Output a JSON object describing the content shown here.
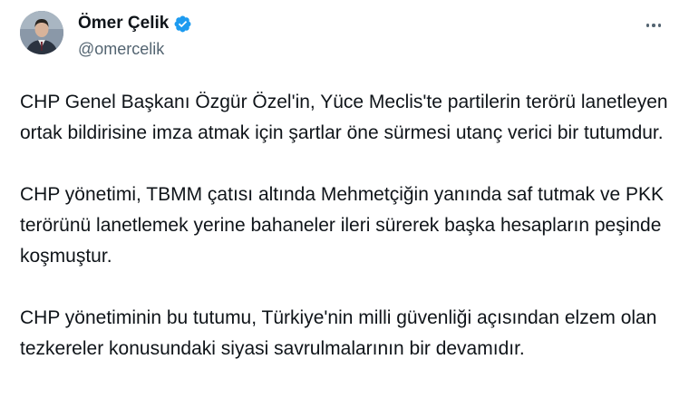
{
  "author": {
    "display_name": "Ömer Çelik",
    "handle": "@omercelik",
    "verified_icon": "verified-badge-icon",
    "verified_color": "#1d9bf0"
  },
  "more_icon": "more-horizontal-icon",
  "tweet": {
    "paragraphs": [
      "CHP Genel Başkanı Özgür Özel'in, Yüce Meclis'te partilerin terörü lanetleyen ortak bildirisine imza atmak için şartlar öne sürmesi utanç verici bir tutumdur.",
      "CHP yönetimi, TBMM çatısı altında Mehmetçiğin yanında saf tutmak ve PKK terörünü lanetlemek yerine bahaneler ileri sürerek başka hesapların peşinde koşmuştur.",
      "CHP yönetiminin bu tutumu, Türkiye'nin milli güvenliği açısından elzem olan tezkereler konusundaki siyasi savrulmalarının bir devamıdır."
    ]
  },
  "colors": {
    "text": "#0f1419",
    "secondary": "#536471",
    "background": "#ffffff"
  }
}
